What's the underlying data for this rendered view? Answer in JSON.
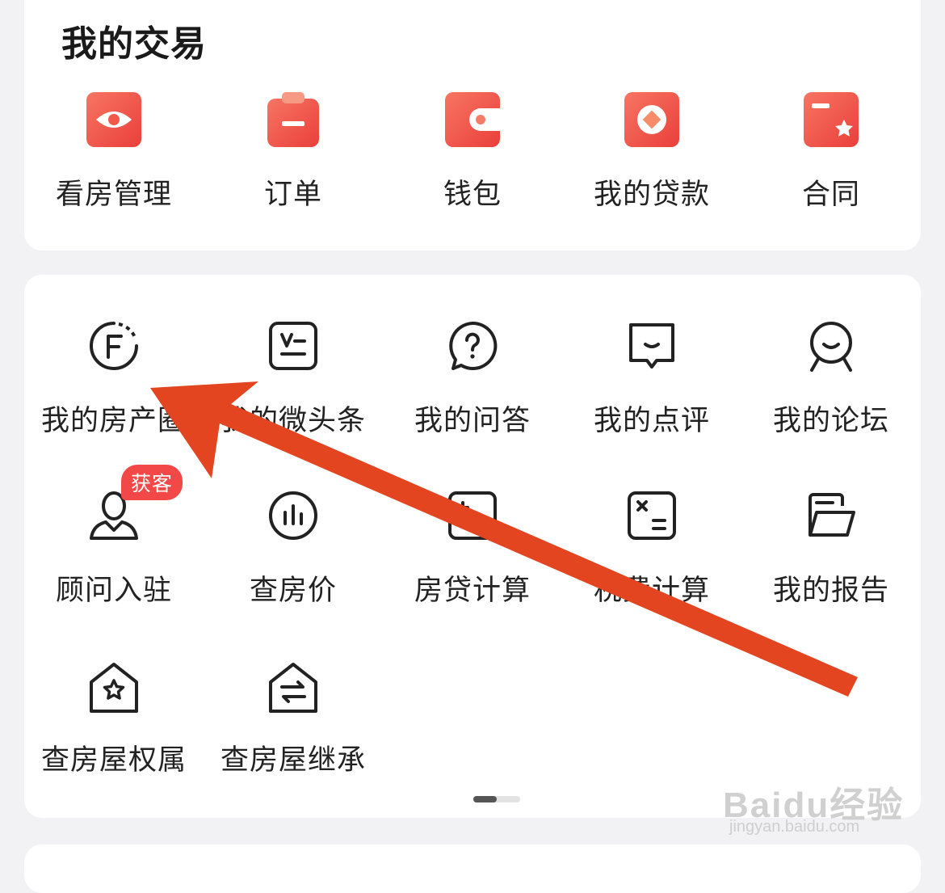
{
  "transactions": {
    "title": "我的交易",
    "items": [
      {
        "label": "看房管理",
        "icon": "eye-icon"
      },
      {
        "label": "订单",
        "icon": "order-clipboard-icon"
      },
      {
        "label": "钱包",
        "icon": "wallet-icon"
      },
      {
        "label": "我的贷款",
        "icon": "loan-diamond-icon"
      },
      {
        "label": "合同",
        "icon": "contract-star-icon"
      }
    ]
  },
  "tools": {
    "items": [
      {
        "label": "我的房产圈",
        "icon": "f-circle-icon"
      },
      {
        "label": "我的微头条",
        "icon": "micro-headline-icon"
      },
      {
        "label": "我的问答",
        "icon": "question-bubble-icon"
      },
      {
        "label": "我的点评",
        "icon": "comment-icon"
      },
      {
        "label": "我的论坛",
        "icon": "forum-person-icon"
      },
      {
        "label": "顾问入驻",
        "icon": "advisor-icon"
      },
      {
        "label": "查房价",
        "icon": "price-chart-icon"
      },
      {
        "label": "房贷计算",
        "icon": "mortgage-calculator-icon"
      },
      {
        "label": "税费计算",
        "icon": "tax-calculator-icon"
      },
      {
        "label": "我的报告",
        "icon": "report-folder-icon"
      },
      {
        "label": "查房屋权属",
        "icon": "house-star-icon"
      },
      {
        "label": "查房屋继承",
        "icon": "house-transfer-icon"
      }
    ],
    "badge": "获客"
  },
  "watermark": {
    "logo": "Baidu经验",
    "url": "jingyan.baidu.com"
  },
  "colors": {
    "accent": "#f05a4a",
    "badge": "#f24848",
    "arrow": "#e2451f"
  }
}
